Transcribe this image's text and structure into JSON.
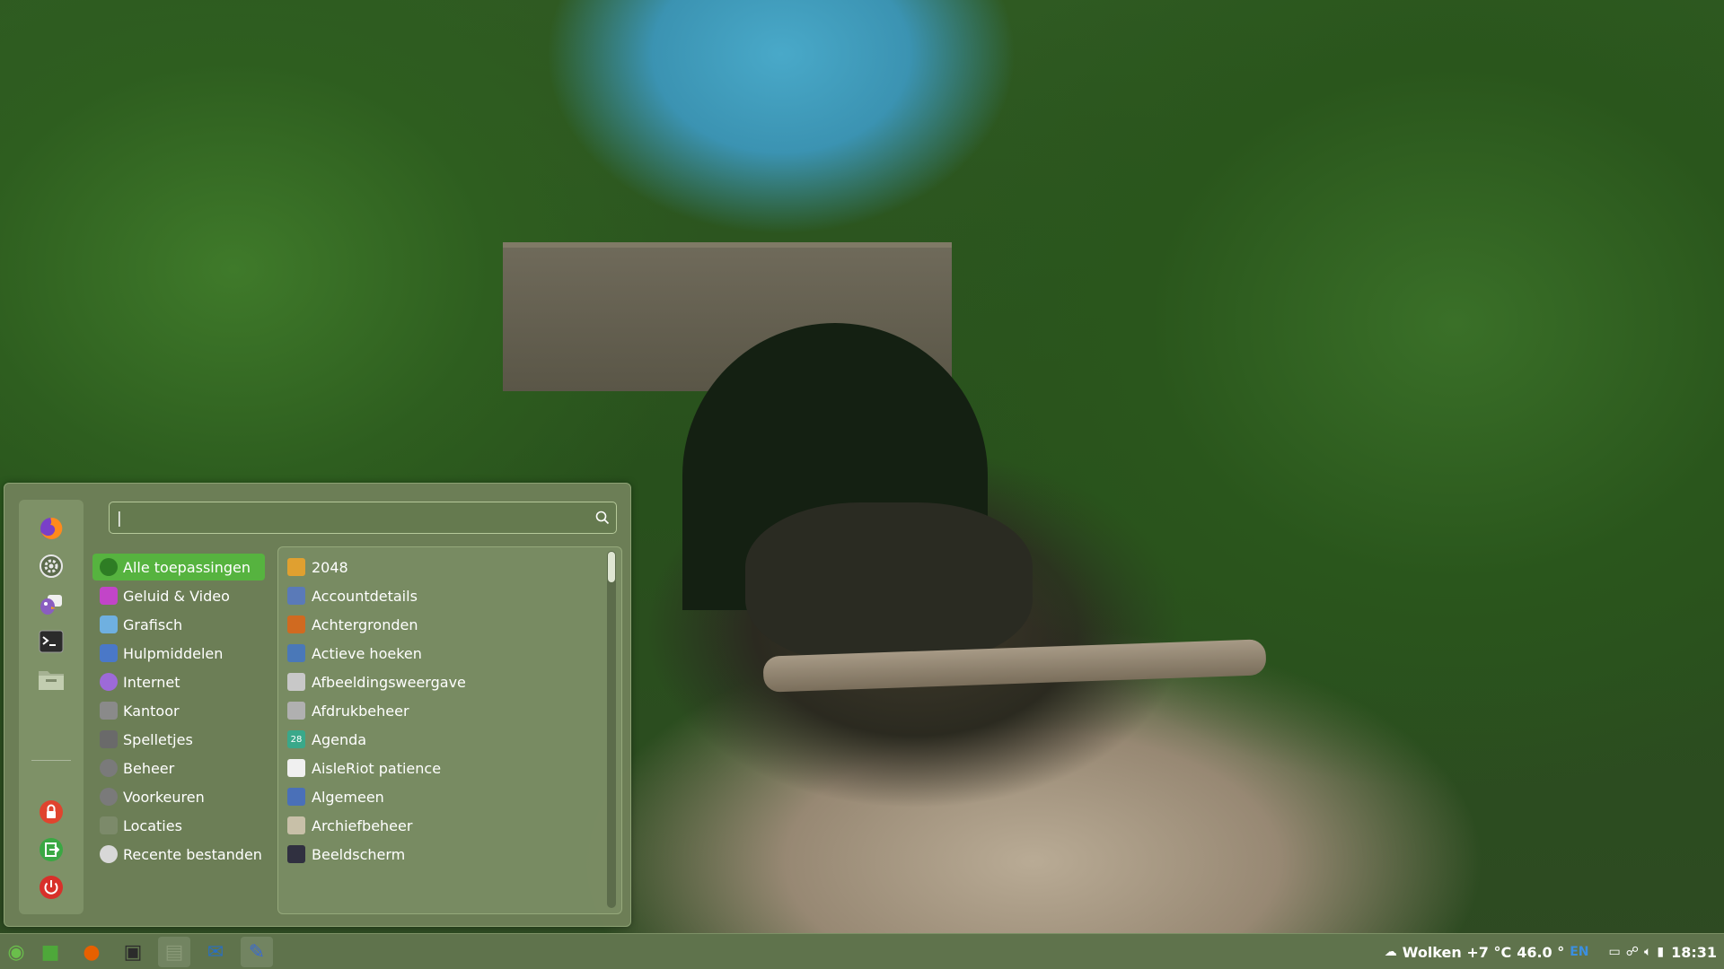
{
  "menu": {
    "search": {
      "value": "|",
      "placeholder": ""
    },
    "favorites": [
      {
        "name": "firefox-icon",
        "color": "#e66000"
      },
      {
        "name": "settings-icon",
        "color": "#6b7d5a"
      },
      {
        "name": "pidgin-icon",
        "color": "#7b5ea7"
      },
      {
        "name": "terminal-icon",
        "color": "#2b2b2b"
      },
      {
        "name": "files-icon",
        "color": "#8a9a78"
      }
    ],
    "session": [
      {
        "name": "lock-icon",
        "color": "#e0442e"
      },
      {
        "name": "logout-icon",
        "color": "#3aa843"
      },
      {
        "name": "power-icon",
        "color": "#d8302a"
      }
    ],
    "categories": [
      {
        "label": "Alle toepassingen",
        "icon": "all-apps-icon",
        "color": "#2e7d24",
        "active": true
      },
      {
        "label": "Geluid & Video",
        "icon": "multimedia-icon",
        "color": "#c245c8"
      },
      {
        "label": "Grafisch",
        "icon": "graphics-icon",
        "color": "#6fb0e0"
      },
      {
        "label": "Hulpmiddelen",
        "icon": "accessories-icon",
        "color": "#4a78c8"
      },
      {
        "label": "Internet",
        "icon": "internet-icon",
        "color": "#9d6ad8"
      },
      {
        "label": "Kantoor",
        "icon": "office-icon",
        "color": "#8a8a8a"
      },
      {
        "label": "Spelletjes",
        "icon": "games-icon",
        "color": "#6a6a6a"
      },
      {
        "label": "Beheer",
        "icon": "administration-icon",
        "color": "#7a7a7a"
      },
      {
        "label": "Voorkeuren",
        "icon": "preferences-icon",
        "color": "#7a7a7a"
      },
      {
        "label": "Locaties",
        "icon": "places-icon",
        "color": "#7c8a6a"
      },
      {
        "label": "Recente bestanden",
        "icon": "recent-icon",
        "color": "#d8d8d8"
      }
    ],
    "apps": [
      {
        "label": "2048",
        "icon": "game-2048-icon",
        "color": "#e0a030"
      },
      {
        "label": "Accountdetails",
        "icon": "account-icon",
        "color": "#5a7ab8"
      },
      {
        "label": "Achtergronden",
        "icon": "backgrounds-icon",
        "color": "#d06a20"
      },
      {
        "label": "Actieve hoeken",
        "icon": "hot-corners-icon",
        "color": "#4a78b8"
      },
      {
        "label": "Afbeeldingsweergave",
        "icon": "image-viewer-icon",
        "color": "#c8c8c8"
      },
      {
        "label": "Afdrukbeheer",
        "icon": "printer-icon",
        "color": "#b0b0b0"
      },
      {
        "label": "Agenda",
        "icon": "calendar-icon",
        "color": "#3aa88a",
        "badge": "28"
      },
      {
        "label": "AisleRiot patience",
        "icon": "cards-icon",
        "color": "#f0f0f0"
      },
      {
        "label": "Algemeen",
        "icon": "general-icon",
        "color": "#4a70b8"
      },
      {
        "label": "Archiefbeheer",
        "icon": "archive-icon",
        "color": "#c8c0a8"
      },
      {
        "label": "Beeldscherm",
        "icon": "display-icon",
        "color": "#303040"
      }
    ]
  },
  "taskbar": {
    "buttons": [
      {
        "name": "menu-button",
        "icon": "mint-logo-icon",
        "color": "#6abf4b"
      },
      {
        "name": "show-desktop-button",
        "icon": "desktop-icon",
        "color": "#4ea83a"
      },
      {
        "name": "firefox-launcher",
        "icon": "firefox-icon",
        "color": "#e66000"
      },
      {
        "name": "terminal-launcher",
        "icon": "terminal-icon",
        "color": "#2b2b2b"
      },
      {
        "name": "files-launcher",
        "icon": "files-icon",
        "color": "#8a9a78",
        "running": true
      },
      {
        "name": "thunderbird-launcher",
        "icon": "thunderbird-icon",
        "color": "#2a6fc0"
      },
      {
        "name": "text-editor-launcher",
        "icon": "text-editor-icon",
        "color": "#3a6ad0",
        "running": true
      }
    ],
    "tray": {
      "weather": "Wolken +7 °C",
      "cpu": "46.0 °",
      "keyboard": "EN",
      "clock": "18:31"
    }
  }
}
